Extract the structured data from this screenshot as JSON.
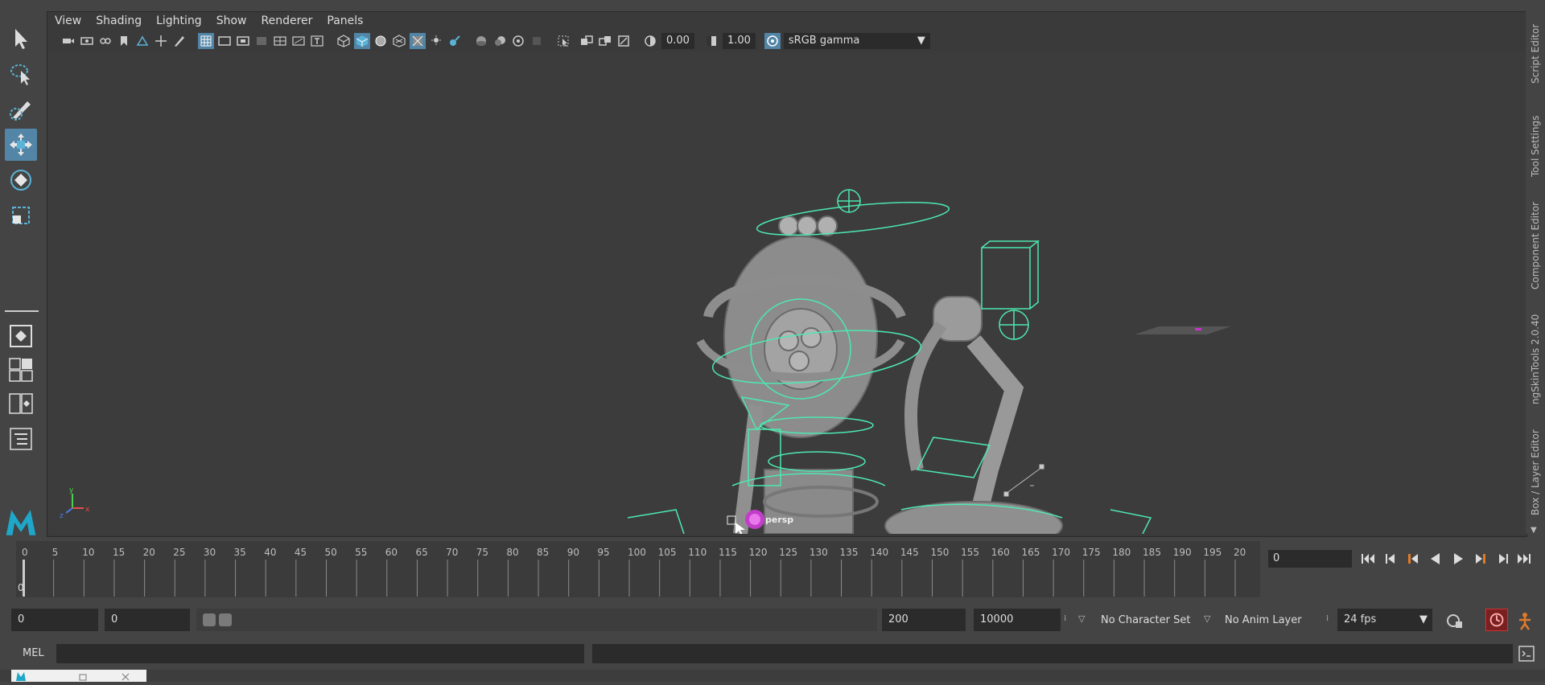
{
  "panel_menu": [
    "View",
    "Shading",
    "Lighting",
    "Show",
    "Renderer",
    "Panels"
  ],
  "panel_toolbar": {
    "exposure_value": "0.00",
    "gamma_value": "1.00",
    "color_space": "sRGB gamma"
  },
  "viewport": {
    "camera_label": "persp",
    "axis_labels": [
      "y",
      "x",
      "z"
    ]
  },
  "right_dock_tabs": [
    "Script Editor",
    "Tool Settings",
    "Component Editor",
    "ngSkinTools 2.0.40",
    "Box / Layer Editor"
  ],
  "timeline": {
    "ticks": [
      "0",
      "5",
      "10",
      "15",
      "20",
      "25",
      "30",
      "35",
      "40",
      "45",
      "50",
      "55",
      "60",
      "65",
      "70",
      "75",
      "80",
      "85",
      "90",
      "95",
      "100",
      "105",
      "110",
      "115",
      "120",
      "125",
      "130",
      "135",
      "140",
      "145",
      "150",
      "155",
      "160",
      "165",
      "170",
      "175",
      "180",
      "185",
      "190",
      "195",
      "20"
    ],
    "current_frame_marker": "0",
    "current_frame_field": "0"
  },
  "range": {
    "start": "0",
    "playback_start": "0",
    "playback_end": "200",
    "end": "10000",
    "character_set": "No Character Set",
    "anim_layer": "No Anim Layer",
    "fps": "24 fps"
  },
  "command_line": {
    "label": "MEL"
  },
  "colors": {
    "accent": "#5285a6",
    "wireframe": "#4de8b0",
    "background": "#444444",
    "viewport_bg": "#3c3c3c"
  }
}
